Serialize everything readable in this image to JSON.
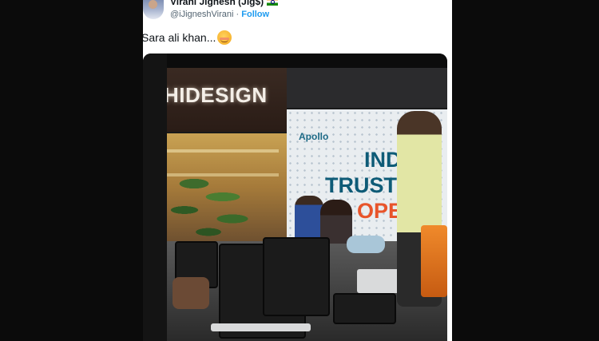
{
  "tweet": {
    "author": {
      "display_name": "Virani Jignesh (Jig$)",
      "flag_icon": "india-flag-icon",
      "handle": "@iJigneshVirani",
      "separator": "·",
      "follow_label": "Follow"
    },
    "text": "Sara ali khan...",
    "emoji_icon": "smiling-face-emoji"
  },
  "photo": {
    "store_sign": "HIDESIGN",
    "banner_brand": "Apollo",
    "banner_lines": [
      "INDI",
      "TRUST",
      "OPE"
    ]
  },
  "colors": {
    "background": "#0b0b0b",
    "card": "#ffffff",
    "link": "#1d9bf0",
    "muted": "#536471",
    "text": "#0f1419"
  }
}
